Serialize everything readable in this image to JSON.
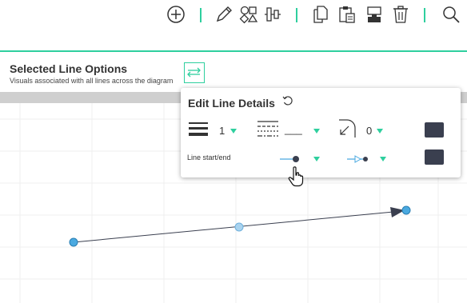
{
  "toolbar": {
    "icons": [
      "add-circle-icon",
      "pencil-icon",
      "shapes-icon",
      "align-distribute-icon",
      "copy-icon",
      "paste-icon",
      "format-painter-icon",
      "trash-icon",
      "search-icon"
    ]
  },
  "panel": {
    "title": "Selected Line Options",
    "subtitle": "Visuals associated with all lines across the diagram"
  },
  "popup": {
    "title": "Edit Line Details",
    "line_weight_value": "1",
    "line_style_value": "___",
    "corner_radius_value": "0",
    "line_start_end_label": "Line start/end"
  },
  "colors": {
    "accent": "#2ecf9e",
    "swatch": "#3a3f4f",
    "node_fill": "#4aa9e0",
    "node_mid_fill": "#a9d3ef",
    "line": "#3a3f4f"
  }
}
